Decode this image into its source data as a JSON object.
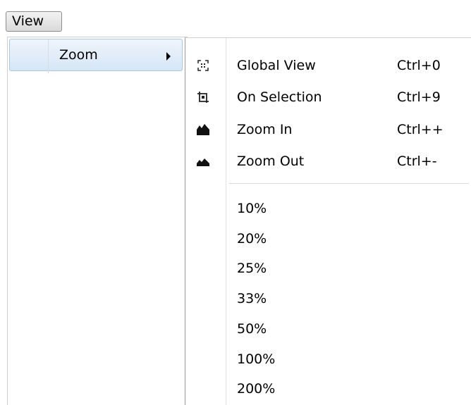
{
  "menubar": {
    "view_label": "View"
  },
  "view_menu": {
    "items": [
      {
        "label": "Zoom",
        "has_submenu": true
      }
    ]
  },
  "zoom_submenu": {
    "commands": [
      {
        "label": "Global View",
        "shortcut": "Ctrl+0",
        "icon": "fit-all-icon"
      },
      {
        "label": "On Selection",
        "shortcut": "Ctrl+9",
        "icon": "zoom-selection-icon"
      },
      {
        "label": "Zoom In",
        "shortcut": "Ctrl++",
        "icon": "zoom-in-icon"
      },
      {
        "label": "Zoom Out",
        "shortcut": "Ctrl+-",
        "icon": "zoom-out-icon"
      }
    ],
    "presets": [
      "10%",
      "20%",
      "25%",
      "33%",
      "50%",
      "100%",
      "200%"
    ]
  },
  "colors": {
    "highlight_border": "#a9c6e4",
    "highlight_fill": "#d6e6f6"
  }
}
